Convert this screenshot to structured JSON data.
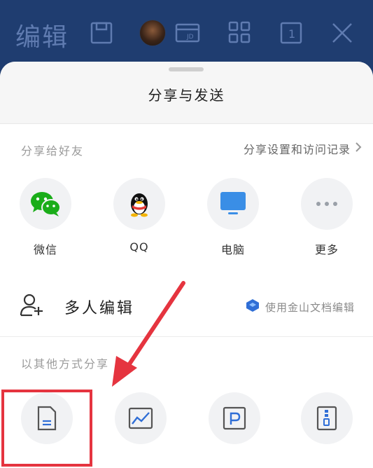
{
  "toolbar": {
    "title": "编辑",
    "icons": [
      "save-icon",
      "avatar",
      "jd-card-icon",
      "grid-icon",
      "page-count-icon",
      "close-icon"
    ],
    "page_count": "1",
    "jd_text": "JD"
  },
  "sheet": {
    "title": "分享与发送",
    "share_friends_label": "分享给好友",
    "share_settings_link": "分享设置和访问记录",
    "share_targets": [
      {
        "label": "微信",
        "icon": "wechat-icon",
        "color": "#1aad19"
      },
      {
        "label": "QQ",
        "icon": "qq-icon",
        "color": "#000000"
      },
      {
        "label": "电脑",
        "icon": "computer-icon",
        "color": "#3a8ee6"
      },
      {
        "label": "更多",
        "icon": "more-icon",
        "color": "#9aa0a8"
      }
    ],
    "multi_edit_label": "多人编辑",
    "wps_link": "使用金山文档编辑",
    "other_ways_label": "以其他方式分享",
    "other_ways": [
      {
        "icon": "document-icon"
      },
      {
        "icon": "long-image-icon"
      },
      {
        "icon": "pdf-icon"
      },
      {
        "icon": "zip-file-icon"
      }
    ]
  },
  "colors": {
    "toolbar_bg": "#1f3d70",
    "highlight": "#e5343f",
    "accent_blue": "#2f6ed6"
  }
}
